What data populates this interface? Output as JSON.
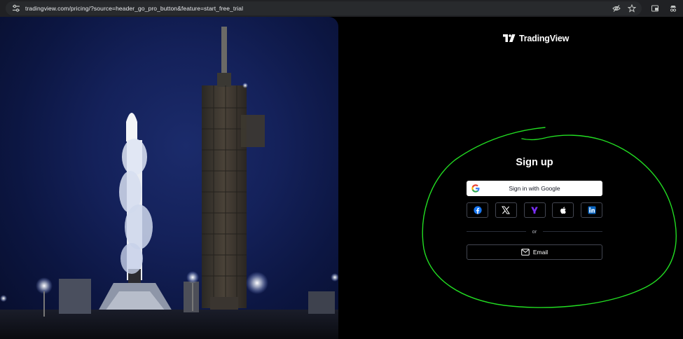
{
  "browser": {
    "url": "tradingview.com/pricing/?source=header_go_pro_button&feature=start_free_trial",
    "icons": [
      "tune-icon",
      "eye-off-icon",
      "star-icon",
      "extension-icon",
      "incognito-icon"
    ]
  },
  "brand": {
    "name": "TradingView",
    "logo_icon": "tradingview-logo-icon"
  },
  "signup": {
    "title": "Sign up",
    "google_label": "Sign in with Google",
    "social": [
      {
        "name": "facebook",
        "icon": "facebook-icon",
        "color": "#1877f2"
      },
      {
        "name": "x",
        "icon": "x-icon",
        "color": "#ffffff"
      },
      {
        "name": "yahoo",
        "icon": "yahoo-icon",
        "color": "#6001d2"
      },
      {
        "name": "apple",
        "icon": "apple-icon",
        "color": "#ffffff"
      },
      {
        "name": "linkedin",
        "icon": "linkedin-icon",
        "color": "#0a66c2"
      }
    ],
    "divider_text": "or",
    "email_label": "Email"
  },
  "colors": {
    "background": "#000000",
    "annotation": "#22dd22",
    "button_border": "#434651"
  }
}
